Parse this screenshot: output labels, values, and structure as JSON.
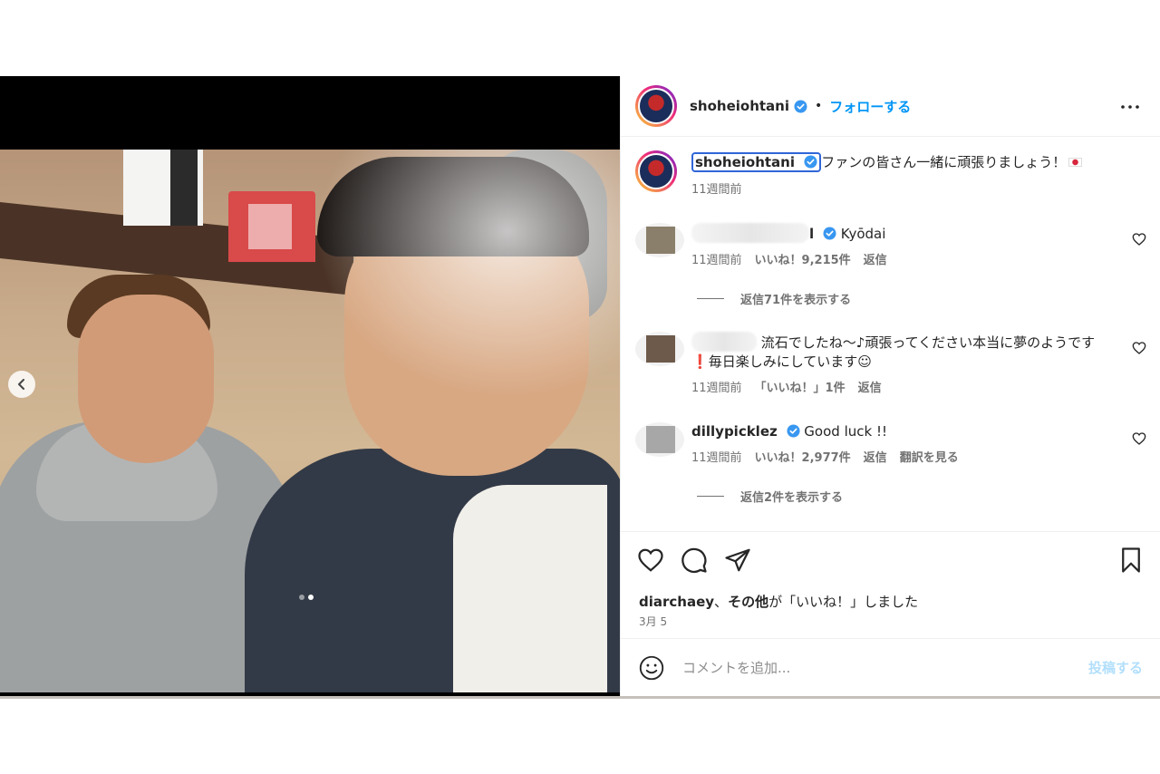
{
  "post": {
    "username": "shoheiohtani",
    "follow_separator": "•",
    "follow_label": "フォローする",
    "caption_text": "ファンの皆さん一緒に頑張りましょう！",
    "caption_time": "11週間前",
    "media": {
      "slide_count": 2,
      "active_slide": 2
    }
  },
  "comments": [
    {
      "username_visible": "l",
      "text": "Kyōdai",
      "time": "11週間前",
      "likes": "いいね！9,215件",
      "reply": "返信",
      "view_replies": "返信71件を表示する"
    },
    {
      "username_visible": "",
      "text": "流石でしたね〜♪頑張ってください本当に夢のようです",
      "text_mark": "❗",
      "text_tail": "毎日楽しみにしています☺︎",
      "time": "11週間前",
      "likes": "「いいね！」1件",
      "reply": "返信"
    },
    {
      "username": "dillypicklez",
      "text": "Good luck !!",
      "time": "11週間前",
      "likes": "いいね！2,977件",
      "reply": "返信",
      "translate": "翻訳を見る",
      "view_replies": "返信2件を表示する"
    }
  ],
  "likes_summary": {
    "user": "diarchaey",
    "sep": "、",
    "others": "その他",
    "suffix": "が「いいね！」しました"
  },
  "post_date": "3月 5",
  "add_comment": {
    "placeholder": "コメントを追加...",
    "post_label": "投稿する"
  },
  "colors": {
    "accent_blue": "#0095f6",
    "verified_blue": "#3897f0",
    "post_disabled": "#b2dffc"
  },
  "icons": [
    "chevron-left-icon",
    "verified-badge-icon",
    "more-icon",
    "heart-icon",
    "comment-icon",
    "share-icon",
    "bookmark-icon",
    "emoji-icon"
  ]
}
